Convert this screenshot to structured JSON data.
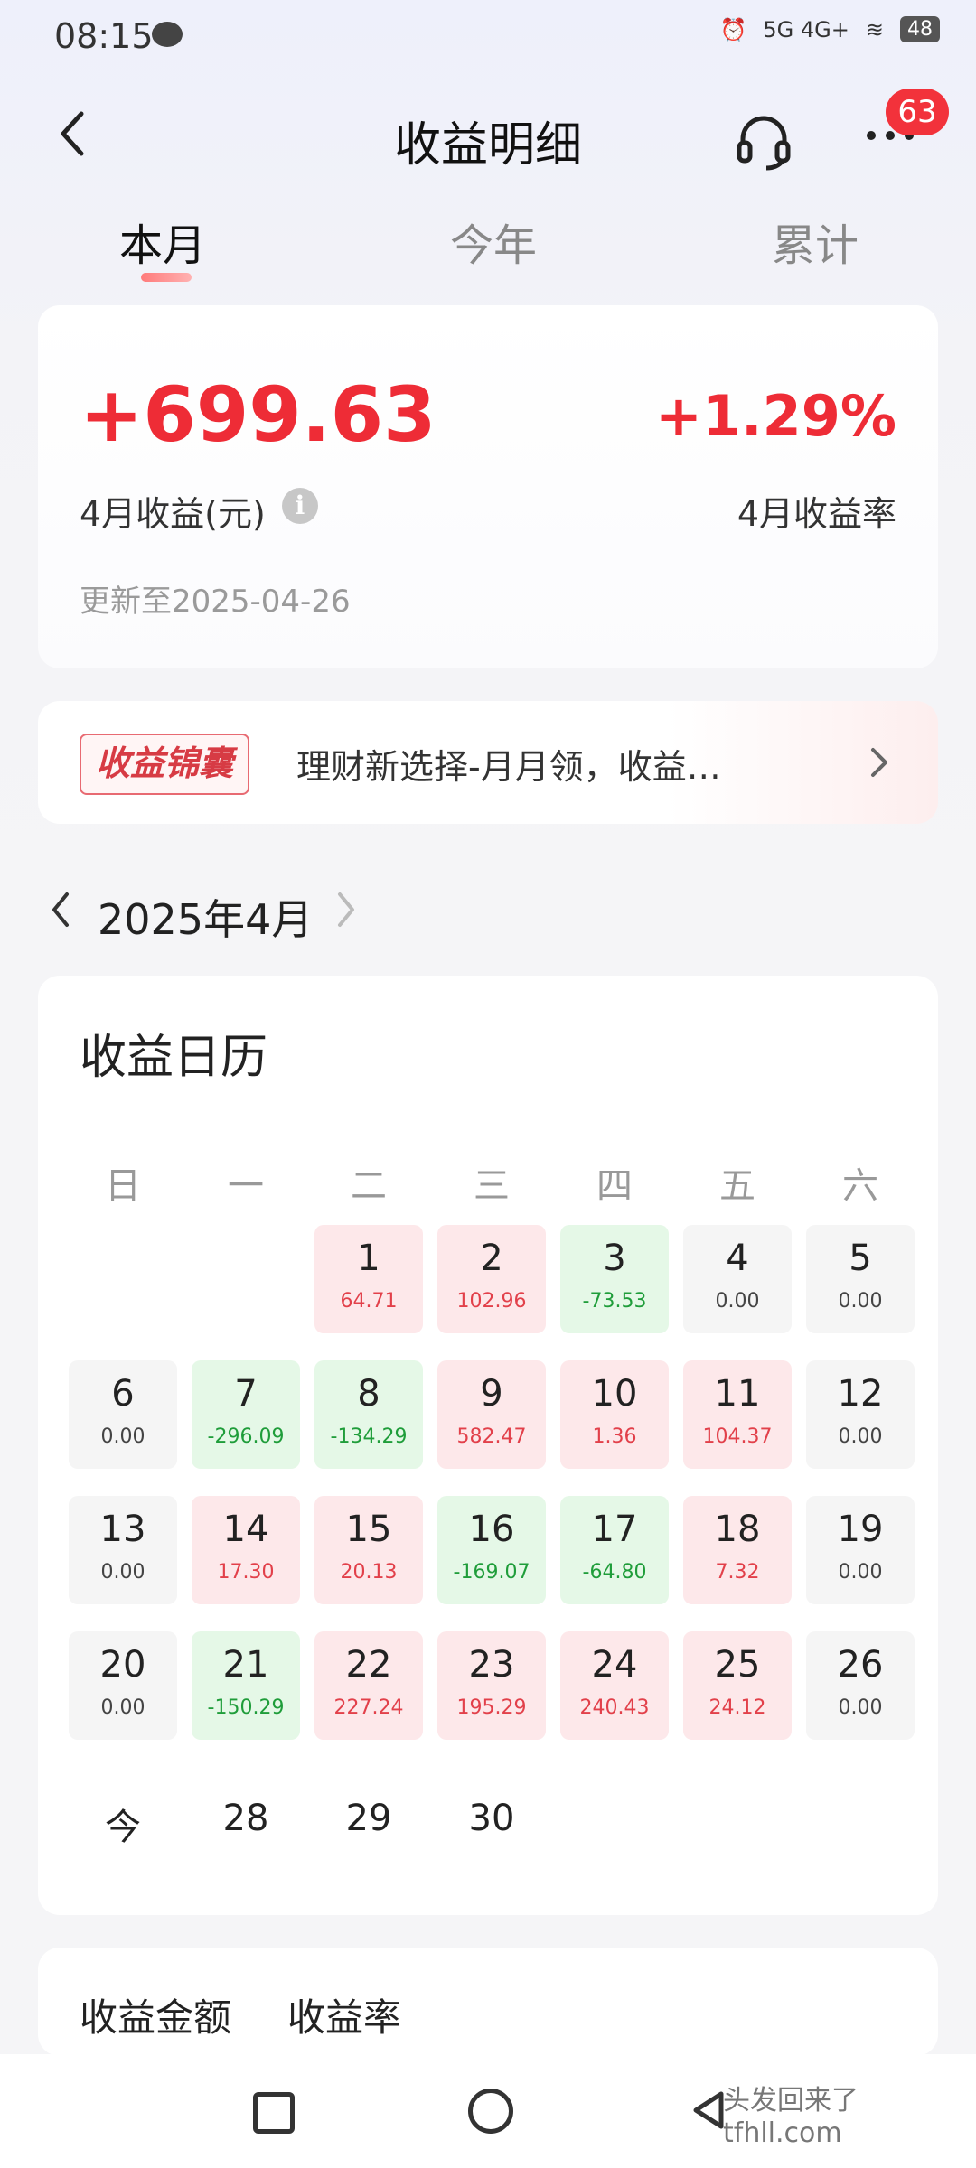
{
  "status_bar": {
    "time": "08:15",
    "battery": "48",
    "network": "5G 4G+"
  },
  "header": {
    "title": "收益明细",
    "badge_count": "63"
  },
  "tabs": [
    {
      "label": "本月"
    },
    {
      "label": "今年"
    },
    {
      "label": "累计"
    }
  ],
  "summary": {
    "amount": "+699.63",
    "amount_label": "4月收益(元)",
    "rate": "+1.29%",
    "rate_label": "4月收益率",
    "updated": "更新至2025-04-26"
  },
  "promo": {
    "tag": "收益锦囊",
    "text": "理财新选择-月月领，收益…"
  },
  "month_nav": {
    "label": "2025年4月"
  },
  "calendar": {
    "title": "收益日历",
    "weekdays": [
      "日",
      "一",
      "二",
      "三",
      "四",
      "五",
      "六"
    ],
    "days": [
      {
        "day": "1",
        "value": "64.71",
        "trend": "pos"
      },
      {
        "day": "2",
        "value": "102.96",
        "trend": "pos"
      },
      {
        "day": "3",
        "value": "-73.53",
        "trend": "neg"
      },
      {
        "day": "4",
        "value": "0.00",
        "trend": "zero"
      },
      {
        "day": "5",
        "value": "0.00",
        "trend": "zero"
      },
      {
        "day": "6",
        "value": "0.00",
        "trend": "zero"
      },
      {
        "day": "7",
        "value": "-296.09",
        "trend": "neg"
      },
      {
        "day": "8",
        "value": "-134.29",
        "trend": "neg"
      },
      {
        "day": "9",
        "value": "582.47",
        "trend": "pos"
      },
      {
        "day": "10",
        "value": "1.36",
        "trend": "pos"
      },
      {
        "day": "11",
        "value": "104.37",
        "trend": "pos"
      },
      {
        "day": "12",
        "value": "0.00",
        "trend": "zero"
      },
      {
        "day": "13",
        "value": "0.00",
        "trend": "zero"
      },
      {
        "day": "14",
        "value": "17.30",
        "trend": "pos"
      },
      {
        "day": "15",
        "value": "20.13",
        "trend": "pos"
      },
      {
        "day": "16",
        "value": "-169.07",
        "trend": "neg"
      },
      {
        "day": "17",
        "value": "-64.80",
        "trend": "neg"
      },
      {
        "day": "18",
        "value": "7.32",
        "trend": "pos"
      },
      {
        "day": "19",
        "value": "0.00",
        "trend": "zero"
      },
      {
        "day": "20",
        "value": "0.00",
        "trend": "zero"
      },
      {
        "day": "21",
        "value": "-150.29",
        "trend": "neg"
      },
      {
        "day": "22",
        "value": "227.24",
        "trend": "pos"
      },
      {
        "day": "23",
        "value": "195.29",
        "trend": "pos"
      },
      {
        "day": "24",
        "value": "240.43",
        "trend": "pos"
      },
      {
        "day": "25",
        "value": "24.12",
        "trend": "pos"
      },
      {
        "day": "26",
        "value": "0.00",
        "trend": "zero"
      }
    ],
    "future_days": [
      "今",
      "28",
      "29",
      "30"
    ]
  },
  "metric_tabs": [
    {
      "label": "收益金额"
    },
    {
      "label": "收益率"
    }
  ],
  "watermark": "头发回来了 tfhll.com",
  "colors": {
    "gain": "#ee2c36",
    "loss": "#1f9d3a",
    "gain_bg": "#fde8ea",
    "loss_bg": "#e5f8e7"
  }
}
